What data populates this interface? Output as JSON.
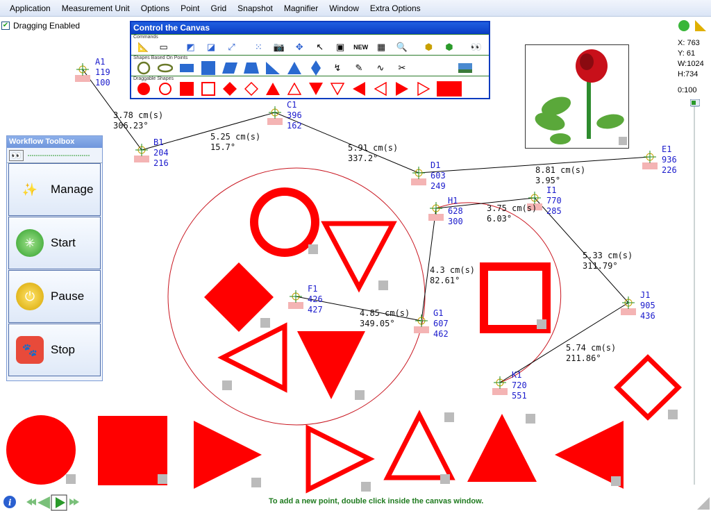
{
  "menu": [
    "Application",
    "Measurement Unit",
    "Options",
    "Point",
    "Grid",
    "Snapshot",
    "Magnifier",
    "Window",
    "Extra Options"
  ],
  "dragging_label": "Dragging Enabled",
  "canvas_ctl": {
    "title": "Control the Canvas",
    "sec_commands": "Commands",
    "sec_shapes_points": "Shapes Based On Points",
    "sec_draggable": "Draggable Shapes",
    "new_label": "NEW"
  },
  "workflow": {
    "title": "Workflow Toolbox",
    "buttons": [
      "Manage",
      "Start",
      "Pause",
      "Stop"
    ]
  },
  "coords": {
    "x": "X: 763",
    "y": "Y: 61",
    "w": "W:1024",
    "h": "H:734",
    "zoom": "0:100"
  },
  "status_msg": "To add a new point, double click inside the canvas window.",
  "points": [
    {
      "name": "A1",
      "x": "119",
      "y": "100"
    },
    {
      "name": "B1",
      "x": "204",
      "y": "216"
    },
    {
      "name": "C1",
      "x": "396",
      "y": "162"
    },
    {
      "name": "D1",
      "x": "603",
      "y": "249"
    },
    {
      "name": "E1",
      "x": "936",
      "y": "226"
    },
    {
      "name": "F1",
      "x": "426",
      "y": "427"
    },
    {
      "name": "G1",
      "x": "607",
      "y": "462"
    },
    {
      "name": "H1",
      "x": "628",
      "y": "300"
    },
    {
      "name": "I1",
      "x": "770",
      "y": "285"
    },
    {
      "name": "J1",
      "x": "905",
      "y": "436"
    },
    {
      "name": "K1",
      "x": "720",
      "y": "551"
    }
  ],
  "measurements": [
    {
      "d": "3.78 cm(s)",
      "a": "306.23°"
    },
    {
      "d": "5.25 cm(s)",
      "a": "15.7°"
    },
    {
      "d": "5.91 cm(s)",
      "a": "337.2°"
    },
    {
      "d": "8.81 cm(s)",
      "a": "3.95°"
    },
    {
      "d": "3.75 cm(s)",
      "a": "6.03°"
    },
    {
      "d": "4.3 cm(s)",
      "a": "82.61°"
    },
    {
      "d": "4.85 cm(s)",
      "a": "349.05°"
    },
    {
      "d": "5.33 cm(s)",
      "a": "311.79°"
    },
    {
      "d": "5.74 cm(s)",
      "a": "211.86°"
    }
  ],
  "colors": {
    "shape_red": "#ff0000",
    "point_blue": "#1a1acc",
    "menu_bg": "#dbe5f6"
  }
}
